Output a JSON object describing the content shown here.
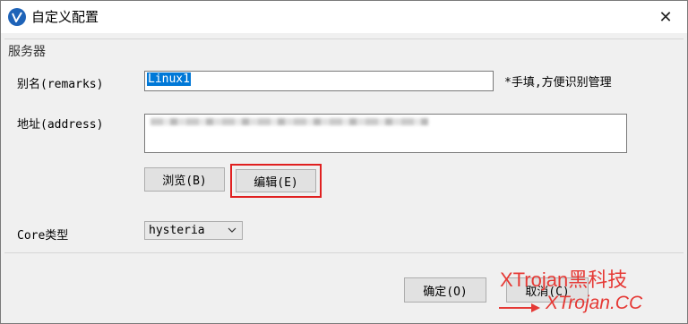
{
  "window": {
    "title": "自定义配置",
    "close_glyph": "✕"
  },
  "group": {
    "title": "服务器"
  },
  "fields": {
    "remarks_label": "别名(remarks)",
    "remarks_value": "Linux1",
    "remarks_hint": "*手填,方便识别管理",
    "address_label": "地址(address)",
    "core_label": "Core类型",
    "core_selected": "hysteria"
  },
  "buttons": {
    "browse": "浏览(B)",
    "edit": "编辑(E)",
    "ok": "确定(O)",
    "cancel": "取消(C)"
  },
  "watermark": {
    "line1": "XTrojan黑科技",
    "line2": "XTrojan.CC"
  },
  "colors": {
    "accent": "#0078d7",
    "highlight_border": "#e02020",
    "watermark": "#e53935",
    "app_icon": "#1e63b8"
  },
  "icons": {
    "app": "v2rayn-logo-icon",
    "close": "close-icon",
    "select_arrow": "chevron-down-icon"
  }
}
